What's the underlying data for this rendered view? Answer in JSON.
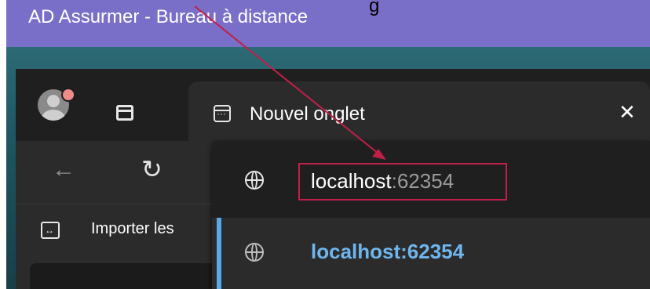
{
  "window": {
    "title": "AD Assurmer - Bureau à distance",
    "clipped_caption_char": "g"
  },
  "browser": {
    "active_tab": {
      "title": "Nouvel onglet",
      "close_glyph": "✕"
    },
    "toolbar": {
      "back_glyph": "←",
      "reload_glyph": "↻"
    },
    "bookmarks_bar": {
      "import_label": "Importer les"
    },
    "address_bar": {
      "host": "localhost",
      "port": ":62354"
    },
    "suggestions": [
      {
        "text": "localhost:62354",
        "icon": "globe-icon",
        "selected": true
      }
    ]
  },
  "colors": {
    "titlebar": "#7a6fc8",
    "annotation": "#c02048",
    "suggestion_text": "#6fb6ee",
    "selected_accent": "#5aa8e6"
  }
}
